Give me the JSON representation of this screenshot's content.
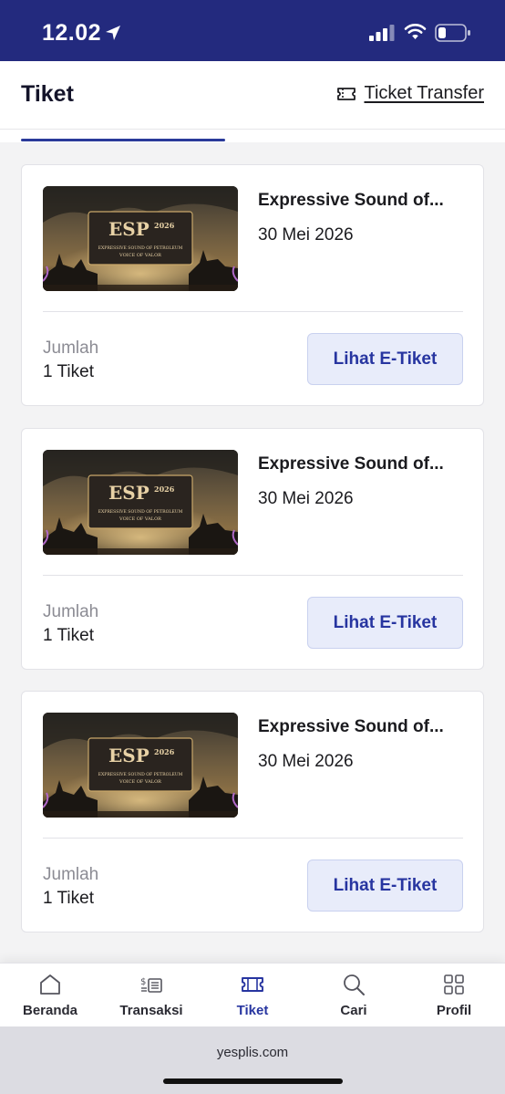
{
  "status": {
    "time": "12.02",
    "icons": [
      "location-arrow-icon",
      "signal-icon",
      "wifi-icon",
      "battery-icon"
    ]
  },
  "header": {
    "title": "Tiket",
    "transfer_label": "Ticket Transfer",
    "transfer_icon": "ticket-icon"
  },
  "colors": {
    "brand": "#232a7e",
    "accent": "#2735a0",
    "button_bg": "#e8ecfa"
  },
  "tickets": [
    {
      "event_name": "Expressive Sound of...",
      "date": "30 Mei 2026",
      "quantity_label": "Jumlah",
      "quantity": "1 Tiket",
      "button_label": "Lihat E-Tiket",
      "poster": {
        "logo": "ESP",
        "year": "2026",
        "subtitle": "EXPRESSIVE SOUND OF PETROLEUM",
        "tagline": "VOICE OF VALOR"
      }
    },
    {
      "event_name": "Expressive Sound of...",
      "date": "30 Mei 2026",
      "quantity_label": "Jumlah",
      "quantity": "1 Tiket",
      "button_label": "Lihat E-Tiket",
      "poster": {
        "logo": "ESP",
        "year": "2026",
        "subtitle": "EXPRESSIVE SOUND OF PETROLEUM",
        "tagline": "VOICE OF VALOR"
      }
    },
    {
      "event_name": "Expressive Sound of...",
      "date": "30 Mei 2026",
      "quantity_label": "Jumlah",
      "quantity": "1 Tiket",
      "button_label": "Lihat E-Tiket",
      "poster": {
        "logo": "ESP",
        "year": "2026",
        "subtitle": "EXPRESSIVE SOUND OF PETROLEUM",
        "tagline": "VOICE OF VALOR"
      }
    }
  ],
  "nav": [
    {
      "label": "Beranda",
      "icon": "home-icon"
    },
    {
      "label": "Transaksi",
      "icon": "receipt-icon"
    },
    {
      "label": "Tiket",
      "icon": "ticket-icon",
      "active": true
    },
    {
      "label": "Cari",
      "icon": "search-icon"
    },
    {
      "label": "Profil",
      "icon": "grid-icon"
    }
  ],
  "browser": {
    "url": "yesplis.com"
  }
}
